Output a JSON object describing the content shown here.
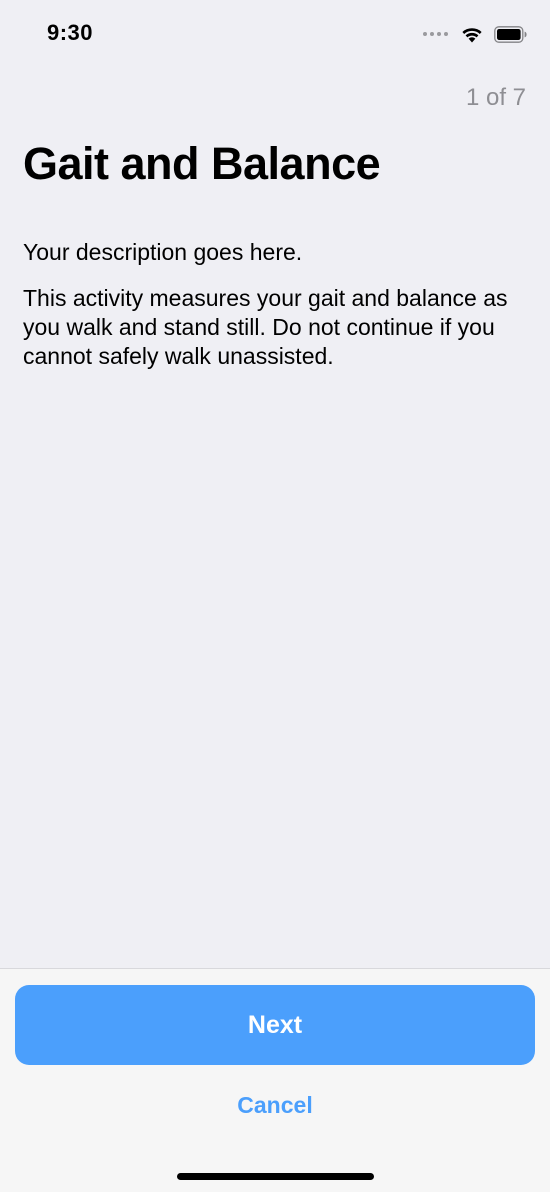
{
  "status_bar": {
    "time": "9:30",
    "icons": [
      "cellular-signal-icon",
      "wifi-icon",
      "battery-icon"
    ]
  },
  "step": {
    "counter": "1 of 7"
  },
  "content": {
    "title": "Gait and Balance",
    "intro": "Your description goes here.",
    "detail": "This activity measures your gait and balance as you walk and stand still. Do not continue if you cannot safely walk unassisted."
  },
  "footer": {
    "next_label": "Next",
    "cancel_label": "Cancel"
  },
  "colors": {
    "background": "#efeff4",
    "accent": "#4b9ffc",
    "secondary_text": "#8e8e93",
    "footer_background": "#f6f6f6"
  }
}
